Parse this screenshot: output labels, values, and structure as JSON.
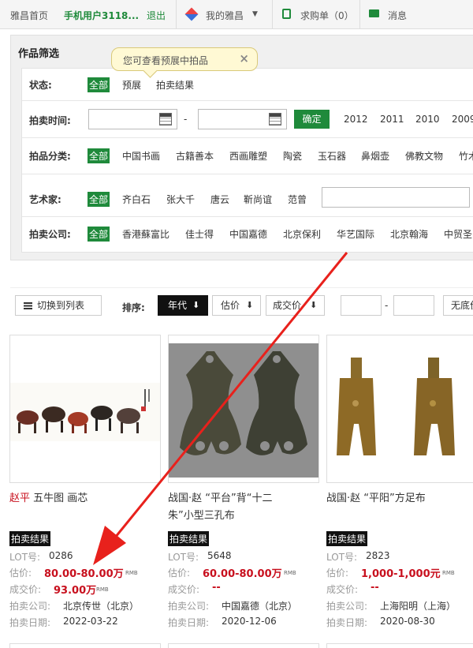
{
  "topbar": {
    "home": "雅昌首页",
    "user": "手机用户3118...",
    "logout": "退出",
    "my_yachang": "我的雅昌",
    "purchase": "求购单（0）",
    "messages": "消息"
  },
  "filter": {
    "heading": "作品筛选",
    "tooltip": "您可查看预展中拍品",
    "tooltip_close": "×",
    "status": {
      "label": "状态:",
      "options": [
        "全部",
        "预展",
        "拍卖结果"
      ]
    },
    "time": {
      "label": "拍卖时间:",
      "dash": "-",
      "confirm": "确定",
      "years": [
        "2012",
        "2011",
        "2010",
        "2009"
      ]
    },
    "category": {
      "label": "拍品分类:",
      "options": [
        "全部",
        "中国书画",
        "古籍善本",
        "西画雕塑",
        "陶瓷",
        "玉石器",
        "鼻烟壶",
        "佛教文物",
        "竹木"
      ]
    },
    "artist": {
      "label": "艺术家:",
      "options": [
        "全部",
        "齐白石",
        "张大千",
        "唐云",
        "靳尚谊",
        "范曾"
      ]
    },
    "company": {
      "label": "拍卖公司:",
      "options": [
        "全部",
        "香港蘇富比",
        "佳士得",
        "中国嘉德",
        "北京保利",
        "华艺国际",
        "北京翰海",
        "中贸圣"
      ]
    }
  },
  "sort": {
    "switch_list": "切换到列表",
    "label": "排序:",
    "year": "年代",
    "estimate": "估价",
    "price": "成交价",
    "dash": "-",
    "unbounded": "无底价"
  },
  "items": [
    {
      "artist": "赵平",
      "title": "五牛图 画芯",
      "title2": "",
      "badge": "拍卖结果",
      "lot_label": "LOT号:",
      "lot": "0286",
      "est_label": "估价:",
      "estimate": "80.00-80.00万",
      "rmb": "RMB",
      "price_label": "成交价:",
      "price": "93.00万",
      "company_label": "拍卖公司:",
      "company": "北京传世（北京）",
      "date_label": "拍卖日期:",
      "date": "2022-03-22"
    },
    {
      "artist": "",
      "title": "战国·赵 “平台”背“十二",
      "title2": "朱”小型三孔布",
      "badge": "拍卖结果",
      "lot_label": "LOT号:",
      "lot": "5648",
      "est_label": "估价:",
      "estimate": "60.00-80.00万",
      "rmb": "RMB",
      "price_label": "成交价:",
      "price": "--",
      "company_label": "拍卖公司:",
      "company": "中国嘉德（北京）",
      "date_label": "拍卖日期:",
      "date": "2020-12-06"
    },
    {
      "artist": "",
      "title": "战国·赵 “平阳”方足布",
      "title2": "",
      "badge": "拍卖结果",
      "lot_label": "LOT号:",
      "lot": "2823",
      "est_label": "估价:",
      "estimate": "1,000-1,000元",
      "rmb": "RMB",
      "price_label": "成交价:",
      "price": "--",
      "company_label": "拍卖公司:",
      "company": "上海阳明（上海）",
      "date_label": "拍卖日期:",
      "date": "2020-08-30"
    }
  ],
  "colors": {
    "accent": "#1f8a3b",
    "price_red": "#c8101e",
    "arrow": "#e8211c"
  },
  "icons": [
    "diamond-icon",
    "cart-icon",
    "mail-icon",
    "calendar-icon",
    "list-icon",
    "arrow-down-icon",
    "close-icon"
  ]
}
